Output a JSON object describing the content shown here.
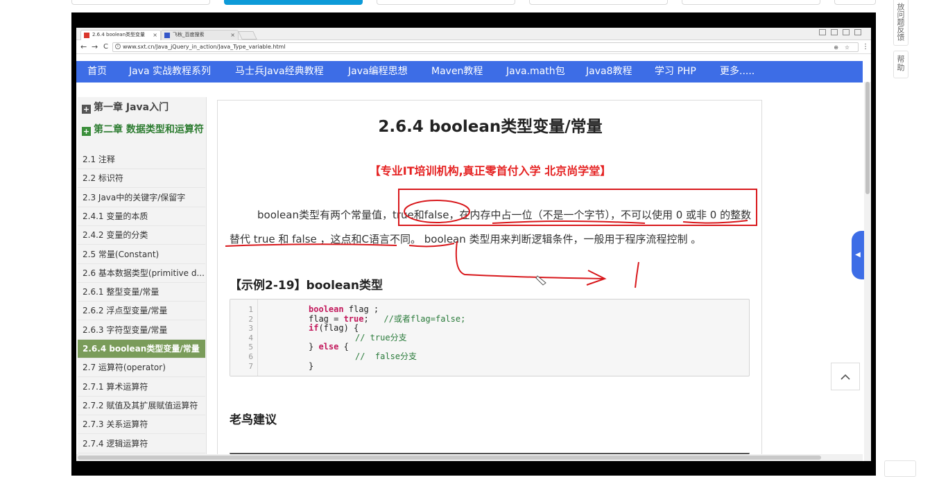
{
  "host": {
    "feedback_label": "放问题反馈",
    "help_label": "帮助"
  },
  "browser": {
    "tabs": [
      {
        "title": "2.6.4 boolean类型变量",
        "close": "×"
      },
      {
        "title": "飞秋_百度搜索",
        "close": "×"
      }
    ],
    "url": "www.sxt.cn/Java_jQuery_in_action/Java_Type_variable.html",
    "nav_back": "←",
    "nav_forward": "→",
    "nav_reload": "C"
  },
  "nav": {
    "items": [
      "首页",
      "Java 实战教程系列",
      "马士兵Java经典教程",
      "Java编程思想",
      "Maven教程",
      "Java.math包",
      "Java8教程",
      "学习 PHP",
      "更多....."
    ]
  },
  "sidebar": {
    "chapter1": "第一章 Java入门",
    "chapter2": "第二章 数据类型和运算符",
    "chapter_icon": "+",
    "items": [
      "2.1 注释",
      "2.2 标识符",
      "2.3 Java中的关键字/保留字",
      "2.4.1 变量的本质",
      "2.4.2 变量的分类",
      "2.5 常量(Constant)",
      "2.6 基本数据类型(primitive d...",
      "2.6.1 整型变量/常量",
      "2.6.2 浮点型变量/常量",
      "2.6.3 字符型变量/常量",
      "2.6.4 boolean类型变量/常量",
      "2.7 运算符(operator)",
      "2.7.1 算术运算符",
      "2.7.2 赋值及其扩展赋值运算符",
      "2.7.3 关系运算符",
      "2.7.4 逻辑运算符"
    ],
    "active_index": 10
  },
  "content": {
    "title": "2.6.4 boolean类型变量/常量",
    "promo": "【专业IT培训机构,真正零首付入学 北京尚学堂】",
    "paragraph": "boolean类型有两个常量值，true和false，在内存中占一位（不是一个字节），不可以使用 0 或非 0 的整数替代 true 和 false ，这点和C语言不同。 boolean 类型用来判断逻辑条件，一般用于程序流程控制 。",
    "example_title": "【示例2-19】boolean类型",
    "code_line_numbers": [
      "1",
      "2",
      "3",
      "4",
      "5",
      "6",
      "7"
    ],
    "code": {
      "l1_kw": "boolean",
      "l1_rest": " flag ;",
      "l2_a": "flag = ",
      "l2_kw": "true",
      "l2_b": ";   ",
      "l2_cm": "//或者flag=false;",
      "l3_kw": "if",
      "l3_rest": "(flag) {",
      "l4_cm": "// true分支",
      "l5_a": "} ",
      "l5_kw": "else",
      "l5_b": " {",
      "l6_cm": "//  false分支",
      "l7": "}"
    },
    "tip_title": "老鸟建议"
  },
  "widgets": {
    "side_tab_icon": "◀",
    "back_to_top_icon": "chevron-up-icon"
  },
  "colors": {
    "nav_blue": "#3d6de6",
    "active_green": "#7a9c5a",
    "promo_red": "#e52222",
    "annotation_red": "#d8171b",
    "host_accent": "#0d9ad8"
  }
}
